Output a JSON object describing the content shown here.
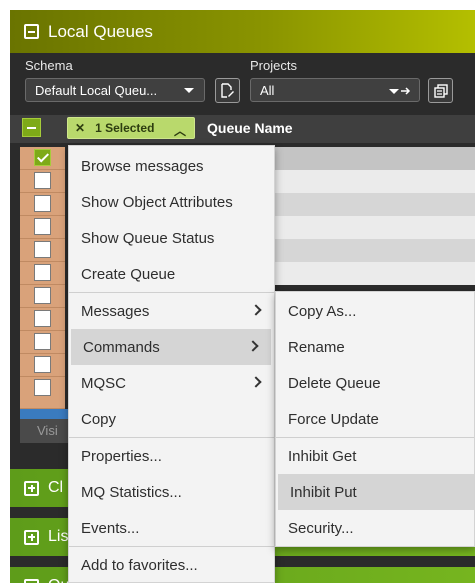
{
  "panel": {
    "title": "Local Queues"
  },
  "schema": {
    "label": "Schema",
    "value": "Default Local Queu..."
  },
  "projects": {
    "label": "Projects",
    "value": "All"
  },
  "grid": {
    "selected_chip": "1 Selected",
    "column_title": "Queue Name",
    "visible_label": "Visi"
  },
  "sections": [
    {
      "label": "Cl"
    },
    {
      "label": "Lis"
    },
    {
      "label": "Qu"
    }
  ],
  "context_menu": {
    "items": [
      {
        "label": "Browse messages"
      },
      {
        "label": "Show Object Attributes"
      },
      {
        "label": "Show Queue Status"
      },
      {
        "label": "Create Queue"
      },
      {
        "label": "Messages"
      },
      {
        "label": "Commands"
      },
      {
        "label": "MQSC"
      },
      {
        "label": "Copy"
      },
      {
        "label": "Properties..."
      },
      {
        "label": "MQ Statistics..."
      },
      {
        "label": "Events..."
      },
      {
        "label": "Add to favorites..."
      }
    ]
  },
  "submenu": {
    "items": [
      {
        "label": "Copy As..."
      },
      {
        "label": "Rename"
      },
      {
        "label": "Delete Queue"
      },
      {
        "label": "Force Update"
      },
      {
        "label": "Inhibit Get"
      },
      {
        "label": "Inhibit Put"
      },
      {
        "label": "Security..."
      }
    ]
  },
  "colors": {
    "header_green": "#8a9400",
    "section_green": "#76b51f",
    "row_orange": "#d9a27a",
    "menu_bg": "#f3f3f3"
  }
}
